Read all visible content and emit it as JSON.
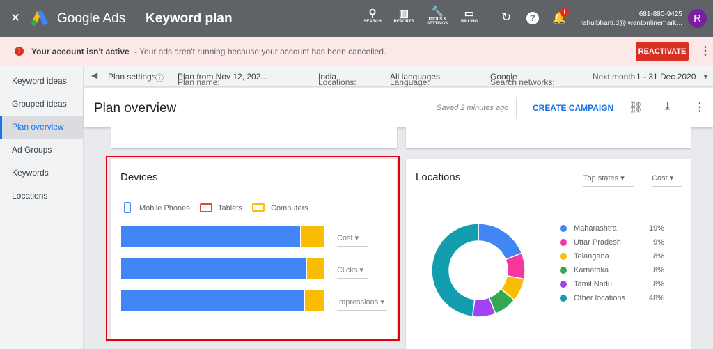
{
  "header": {
    "close": "✕",
    "brand": "Google Ads",
    "page": "Keyword plan",
    "nav": [
      {
        "icon": "search-icon",
        "label": "SEARCH"
      },
      {
        "icon": "reports-icon",
        "label": "REPORTS"
      },
      {
        "icon": "wrench-icon",
        "label": "TOOLS &"
      },
      {
        "icon": "billing-icon",
        "label": "BILLING"
      }
    ],
    "nav_tools_line2": "SETTINGS",
    "phone": "681-880-9425",
    "email": "rahulbharti.d@iwantonlinemark...",
    "avatar": "R",
    "badge": "!"
  },
  "alert": {
    "title": "Your account isn't active",
    "text": " - Your ads aren't running because your account has been cancelled.",
    "button": "REACTIVATE"
  },
  "sidebar": {
    "items": [
      {
        "label": "Keyword ideas"
      },
      {
        "label": "Grouped ideas"
      },
      {
        "label": "Plan overview"
      },
      {
        "label": "Ad Groups"
      },
      {
        "label": "Keywords"
      },
      {
        "label": "Locations"
      }
    ]
  },
  "plan_bar": {
    "settings": "Plan settings",
    "name_label": "Plan name:",
    "name": "Plan from Nov 12, 202...",
    "loc_label": "Locations:",
    "loc": "India",
    "lang_label": "Language:",
    "lang": "All languages",
    "net_label": "Search networks:",
    "net": "Google",
    "period_label": "Next month",
    "period": "1 - 31 Dec 2020"
  },
  "overview": {
    "title": "Plan overview",
    "saved": "Saved 2 minutes ago",
    "create": "CREATE CAMPAIGN"
  },
  "devices": {
    "title": "Devices",
    "legend": [
      "Mobile Phones",
      "Tablets",
      "Computers"
    ],
    "colors": {
      "mobile": "#4285f4",
      "tablets": "#ea4335",
      "computers": "#fbbc04"
    },
    "rows": [
      {
        "metric": "Cost",
        "mobile_pct": 88,
        "tablet_pct": 0,
        "computer_pct": 12
      },
      {
        "metric": "Clicks",
        "mobile_pct": 91,
        "tablet_pct": 0,
        "computer_pct": 9
      },
      {
        "metric": "Impressions",
        "mobile_pct": 90,
        "tablet_pct": 0,
        "computer_pct": 10
      }
    ]
  },
  "locations": {
    "title": "Locations",
    "filter": "Top states",
    "metric": "Cost",
    "items": [
      {
        "name": "Maharashtra",
        "pct": "19%",
        "value": 19,
        "color": "#4285f4"
      },
      {
        "name": "Uttar Pradesh",
        "pct": "9%",
        "value": 9,
        "color": "#f538a0"
      },
      {
        "name": "Telangana",
        "pct": "8%",
        "value": 8,
        "color": "#fbbc04"
      },
      {
        "name": "Karnataka",
        "pct": "8%",
        "value": 8,
        "color": "#34a853"
      },
      {
        "name": "Tamil Nadu",
        "pct": "8%",
        "value": 8,
        "color": "#a142f4"
      },
      {
        "name": "Other locations",
        "pct": "48%",
        "value": 48,
        "color": "#129eaf"
      }
    ]
  }
}
